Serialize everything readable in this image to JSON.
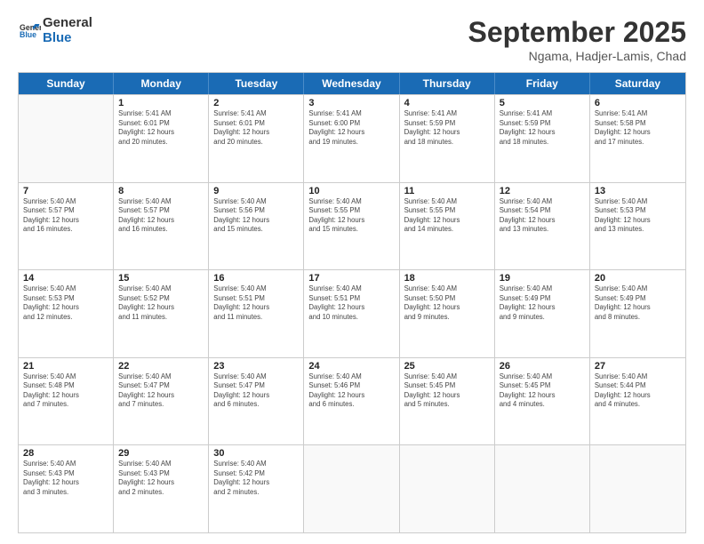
{
  "logo": {
    "line1": "General",
    "line2": "Blue"
  },
  "header": {
    "month": "September 2025",
    "location": "Ngama, Hadjer-Lamis, Chad"
  },
  "days": [
    "Sunday",
    "Monday",
    "Tuesday",
    "Wednesday",
    "Thursday",
    "Friday",
    "Saturday"
  ],
  "rows": [
    [
      {
        "day": "",
        "info": ""
      },
      {
        "day": "1",
        "info": "Sunrise: 5:41 AM\nSunset: 6:01 PM\nDaylight: 12 hours\nand 20 minutes."
      },
      {
        "day": "2",
        "info": "Sunrise: 5:41 AM\nSunset: 6:01 PM\nDaylight: 12 hours\nand 20 minutes."
      },
      {
        "day": "3",
        "info": "Sunrise: 5:41 AM\nSunset: 6:00 PM\nDaylight: 12 hours\nand 19 minutes."
      },
      {
        "day": "4",
        "info": "Sunrise: 5:41 AM\nSunset: 5:59 PM\nDaylight: 12 hours\nand 18 minutes."
      },
      {
        "day": "5",
        "info": "Sunrise: 5:41 AM\nSunset: 5:59 PM\nDaylight: 12 hours\nand 18 minutes."
      },
      {
        "day": "6",
        "info": "Sunrise: 5:41 AM\nSunset: 5:58 PM\nDaylight: 12 hours\nand 17 minutes."
      }
    ],
    [
      {
        "day": "7",
        "info": "Sunrise: 5:40 AM\nSunset: 5:57 PM\nDaylight: 12 hours\nand 16 minutes."
      },
      {
        "day": "8",
        "info": "Sunrise: 5:40 AM\nSunset: 5:57 PM\nDaylight: 12 hours\nand 16 minutes."
      },
      {
        "day": "9",
        "info": "Sunrise: 5:40 AM\nSunset: 5:56 PM\nDaylight: 12 hours\nand 15 minutes."
      },
      {
        "day": "10",
        "info": "Sunrise: 5:40 AM\nSunset: 5:55 PM\nDaylight: 12 hours\nand 15 minutes."
      },
      {
        "day": "11",
        "info": "Sunrise: 5:40 AM\nSunset: 5:55 PM\nDaylight: 12 hours\nand 14 minutes."
      },
      {
        "day": "12",
        "info": "Sunrise: 5:40 AM\nSunset: 5:54 PM\nDaylight: 12 hours\nand 13 minutes."
      },
      {
        "day": "13",
        "info": "Sunrise: 5:40 AM\nSunset: 5:53 PM\nDaylight: 12 hours\nand 13 minutes."
      }
    ],
    [
      {
        "day": "14",
        "info": "Sunrise: 5:40 AM\nSunset: 5:53 PM\nDaylight: 12 hours\nand 12 minutes."
      },
      {
        "day": "15",
        "info": "Sunrise: 5:40 AM\nSunset: 5:52 PM\nDaylight: 12 hours\nand 11 minutes."
      },
      {
        "day": "16",
        "info": "Sunrise: 5:40 AM\nSunset: 5:51 PM\nDaylight: 12 hours\nand 11 minutes."
      },
      {
        "day": "17",
        "info": "Sunrise: 5:40 AM\nSunset: 5:51 PM\nDaylight: 12 hours\nand 10 minutes."
      },
      {
        "day": "18",
        "info": "Sunrise: 5:40 AM\nSunset: 5:50 PM\nDaylight: 12 hours\nand 9 minutes."
      },
      {
        "day": "19",
        "info": "Sunrise: 5:40 AM\nSunset: 5:49 PM\nDaylight: 12 hours\nand 9 minutes."
      },
      {
        "day": "20",
        "info": "Sunrise: 5:40 AM\nSunset: 5:49 PM\nDaylight: 12 hours\nand 8 minutes."
      }
    ],
    [
      {
        "day": "21",
        "info": "Sunrise: 5:40 AM\nSunset: 5:48 PM\nDaylight: 12 hours\nand 7 minutes."
      },
      {
        "day": "22",
        "info": "Sunrise: 5:40 AM\nSunset: 5:47 PM\nDaylight: 12 hours\nand 7 minutes."
      },
      {
        "day": "23",
        "info": "Sunrise: 5:40 AM\nSunset: 5:47 PM\nDaylight: 12 hours\nand 6 minutes."
      },
      {
        "day": "24",
        "info": "Sunrise: 5:40 AM\nSunset: 5:46 PM\nDaylight: 12 hours\nand 6 minutes."
      },
      {
        "day": "25",
        "info": "Sunrise: 5:40 AM\nSunset: 5:45 PM\nDaylight: 12 hours\nand 5 minutes."
      },
      {
        "day": "26",
        "info": "Sunrise: 5:40 AM\nSunset: 5:45 PM\nDaylight: 12 hours\nand 4 minutes."
      },
      {
        "day": "27",
        "info": "Sunrise: 5:40 AM\nSunset: 5:44 PM\nDaylight: 12 hours\nand 4 minutes."
      }
    ],
    [
      {
        "day": "28",
        "info": "Sunrise: 5:40 AM\nSunset: 5:43 PM\nDaylight: 12 hours\nand 3 minutes."
      },
      {
        "day": "29",
        "info": "Sunrise: 5:40 AM\nSunset: 5:43 PM\nDaylight: 12 hours\nand 2 minutes."
      },
      {
        "day": "30",
        "info": "Sunrise: 5:40 AM\nSunset: 5:42 PM\nDaylight: 12 hours\nand 2 minutes."
      },
      {
        "day": "",
        "info": ""
      },
      {
        "day": "",
        "info": ""
      },
      {
        "day": "",
        "info": ""
      },
      {
        "day": "",
        "info": ""
      }
    ]
  ]
}
